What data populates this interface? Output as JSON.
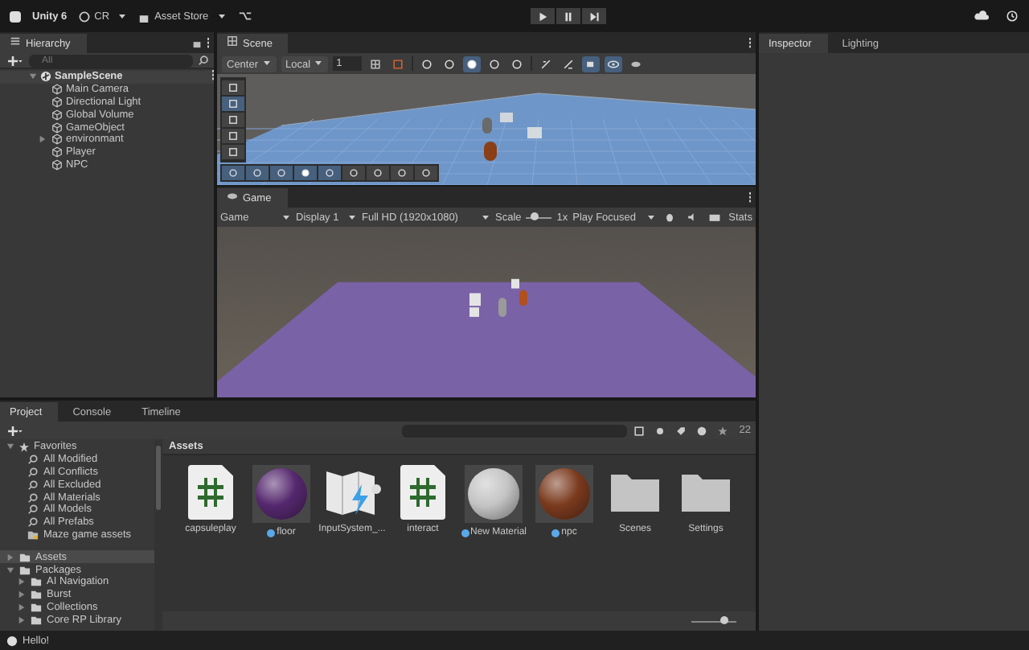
{
  "toolbar": {
    "product": "Unity 6",
    "account": "CR",
    "asset_store": "Asset Store"
  },
  "hierarchy": {
    "title": "Hierarchy",
    "search_placeholder": "All",
    "scene": "SampleScene",
    "items": [
      {
        "name": "Main Camera",
        "kind": "object"
      },
      {
        "name": "Directional Light",
        "kind": "object"
      },
      {
        "name": "Global Volume",
        "kind": "object"
      },
      {
        "name": "GameObject",
        "kind": "object"
      },
      {
        "name": "environmant",
        "kind": "group"
      },
      {
        "name": "Player",
        "kind": "object"
      },
      {
        "name": "NPC",
        "kind": "object"
      }
    ]
  },
  "scene_view": {
    "title": "Scene",
    "pivot": "Center",
    "space": "Local",
    "grid_size": "1"
  },
  "game_view": {
    "title": "Game",
    "mode": "Game",
    "display": "Display 1",
    "resolution": "Full HD (1920x1080)",
    "scale_label": "Scale",
    "scale": {
      "level": 0.3
    },
    "scale_value": "1x",
    "play_mode": "Play Focused",
    "stats": "Stats"
  },
  "inspector_tabs": [
    {
      "label": "Inspector",
      "selected": true
    },
    {
      "label": "Lighting",
      "selected": false
    }
  ],
  "project_tabs": [
    {
      "label": "Project",
      "selected": true
    },
    {
      "label": "Console",
      "selected": false
    },
    {
      "label": "Timeline",
      "selected": false
    }
  ],
  "favorites": {
    "title": "Favorites",
    "items": [
      {
        "name": "All Modified",
        "kind": "search"
      },
      {
        "name": "All Conflicts",
        "kind": "search"
      },
      {
        "name": "All Excluded",
        "kind": "search"
      },
      {
        "name": "All Materials",
        "kind": "search"
      },
      {
        "name": "All Models",
        "kind": "search"
      },
      {
        "name": "All Prefabs",
        "kind": "search"
      },
      {
        "name": "Maze game assets",
        "kind": "folder"
      }
    ]
  },
  "folders": [
    {
      "name": "Assets",
      "selected": true,
      "expanded": false
    },
    {
      "name": "Packages",
      "selected": false,
      "expanded": true,
      "children": [
        {
          "name": "AI Navigation"
        },
        {
          "name": "Burst"
        },
        {
          "name": "Collections"
        },
        {
          "name": "Core RP Library"
        }
      ]
    }
  ],
  "assets": {
    "breadcrumb": "Assets",
    "count": "22",
    "zoom": {
      "level": 0.72
    },
    "items": [
      {
        "name": "capsuleplay",
        "kind": "script"
      },
      {
        "name": "floor",
        "kind": "material",
        "color": "#55286e"
      },
      {
        "name": "InputSystem_...",
        "kind": "input"
      },
      {
        "name": "interact",
        "kind": "script"
      },
      {
        "name": "New Material",
        "kind": "material",
        "color": "#c4c4c4"
      },
      {
        "name": "npc",
        "kind": "material",
        "color": "#7a3a1e"
      },
      {
        "name": "Scenes",
        "kind": "folder"
      },
      {
        "name": "Settings",
        "kind": "folder"
      }
    ]
  },
  "status_bar": {
    "message": "Hello!"
  }
}
